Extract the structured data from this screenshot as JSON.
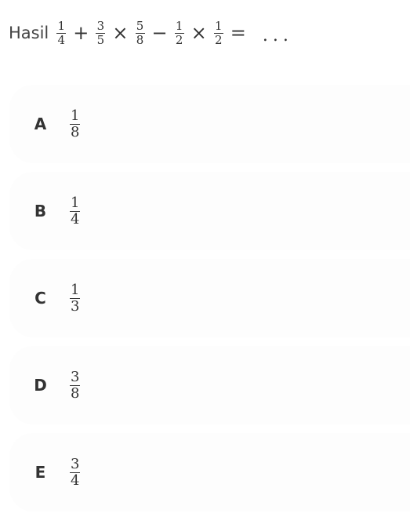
{
  "question": {
    "prefix": "Hasil",
    "terms": [
      {
        "num": "1",
        "den": "4"
      },
      {
        "op": "+"
      },
      {
        "num": "3",
        "den": "5"
      },
      {
        "op": "×"
      },
      {
        "num": "5",
        "den": "8"
      },
      {
        "op": "−"
      },
      {
        "num": "1",
        "den": "2"
      },
      {
        "op": "×"
      },
      {
        "num": "1",
        "den": "2"
      },
      {
        "op": "="
      }
    ],
    "suffix": "..."
  },
  "options": [
    {
      "letter": "A",
      "num": "1",
      "den": "8"
    },
    {
      "letter": "B",
      "num": "1",
      "den": "4"
    },
    {
      "letter": "C",
      "num": "1",
      "den": "3"
    },
    {
      "letter": "D",
      "num": "3",
      "den": "8"
    },
    {
      "letter": "E",
      "num": "3",
      "den": "4"
    }
  ]
}
